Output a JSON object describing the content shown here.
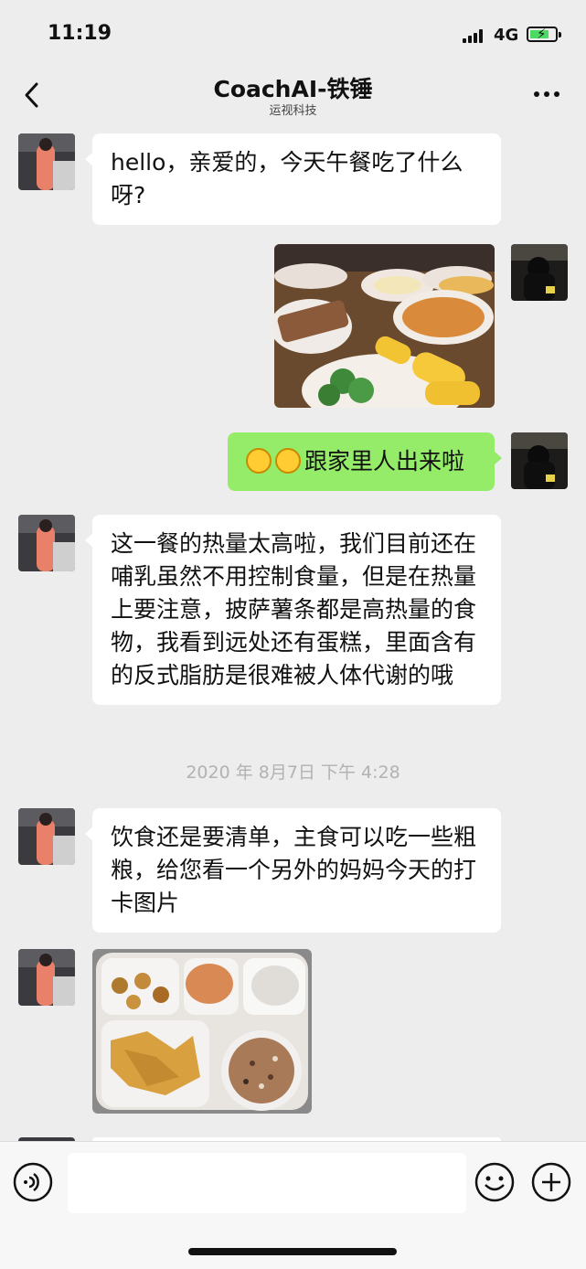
{
  "status": {
    "time": "11:19",
    "network": "4G"
  },
  "nav": {
    "title": "CoachAI-铁锤",
    "subtitle": "运视科技"
  },
  "messages": {
    "m1": "hello，亲爱的，今天午餐吃了什么呀?",
    "m3": "跟家里人出来啦",
    "m4": "这一餐的热量太高啦，我们目前还在哺乳虽然不用控制食量，但是在热量上要注意，披萨薯条都是高热量的食物，我看到远处还有蛋糕，里面含有的反式脂肪是很难被人体代谢的哦",
    "timestamp": "2020 年 8月7日 下午 4:28",
    "m5": "饮食还是要清单，主食可以吃一些粗粮，给您看一个另外的妈妈今天的打卡图片"
  },
  "colors": {
    "self_bubble": "#95ec69",
    "other_bubble": "#ffffff",
    "background": "#ededed"
  },
  "icons": {
    "back": "chevron-left-icon",
    "more": "ellipsis-icon",
    "voice": "voice-icon",
    "emoji": "smiley-icon",
    "plus": "plus-icon"
  }
}
